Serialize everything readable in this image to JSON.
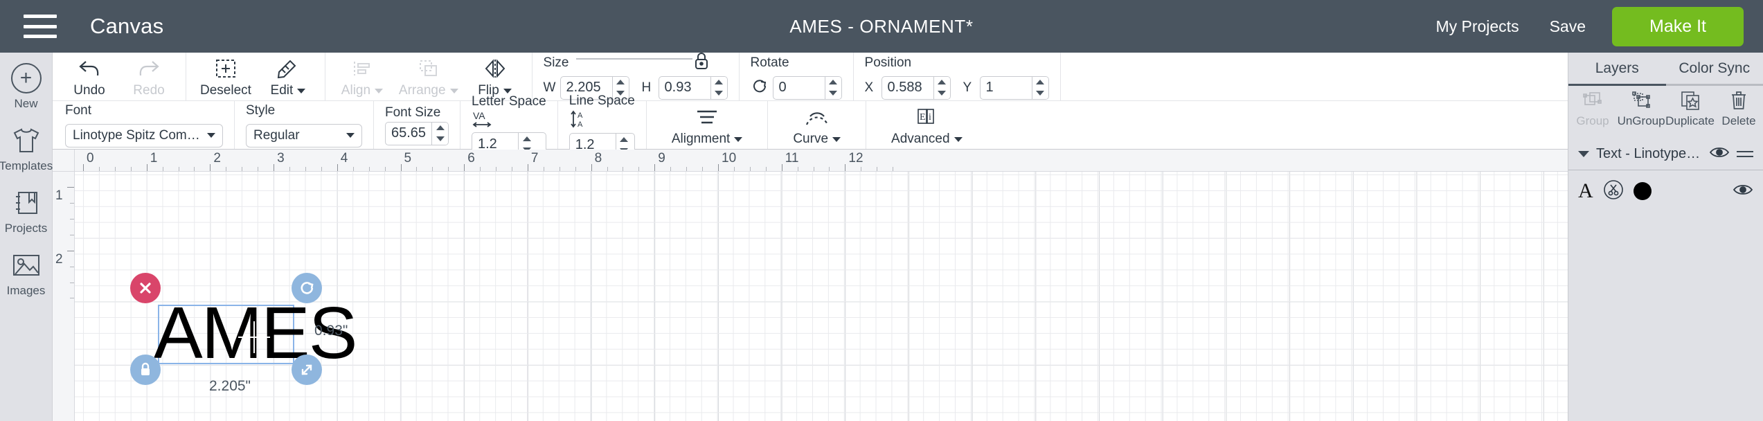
{
  "topbar": {
    "menu_icon": "hamburger-icon",
    "canvas_label": "Canvas",
    "document_title": "AMES - ORNAMENT*",
    "my_projects": "My Projects",
    "save": "Save",
    "make_it": "Make It",
    "accent_green": "#74bc1f",
    "bar_color": "#4a5560"
  },
  "rail": {
    "items": [
      {
        "label": "New",
        "icon": "plus-circle-icon"
      },
      {
        "label": "Templates",
        "icon": "tshirt-icon"
      },
      {
        "label": "Projects",
        "icon": "bookmark-book-icon"
      },
      {
        "label": "Images",
        "icon": "image-icon"
      }
    ]
  },
  "toolbar_row1": {
    "history": [
      {
        "label": "Undo",
        "icon": "undo-arrow-icon",
        "disabled": false
      },
      {
        "label": "Redo",
        "icon": "redo-arrow-icon",
        "disabled": true
      }
    ],
    "edit_group": [
      {
        "label": "Deselect",
        "icon": "deselect-icon",
        "disabled": false
      },
      {
        "label": "Edit",
        "icon": "edit-pencil-ruler-icon",
        "disabled": false,
        "caret": true
      }
    ],
    "object_group": [
      {
        "label": "Align",
        "icon": "align-icon",
        "disabled": true,
        "caret": true
      },
      {
        "label": "Arrange",
        "icon": "arrange-icon",
        "disabled": true,
        "caret": true
      },
      {
        "label": "Flip",
        "icon": "flip-icon",
        "disabled": false,
        "caret": true
      }
    ],
    "size": {
      "label": "Size",
      "lock_icon": "lock-closed-icon",
      "w_axis": "W",
      "w_value": "2.205",
      "h_axis": "H",
      "h_value": "0.93"
    },
    "rotate": {
      "label": "Rotate",
      "icon": "rotate-icon",
      "value": "0"
    },
    "position": {
      "label": "Position",
      "x_axis": "X",
      "x_value": "0.588",
      "y_axis": "Y",
      "y_value": "1"
    }
  },
  "toolbar_row2": {
    "font": {
      "label": "Font",
      "value": "Linotype Spitz Com Light"
    },
    "style": {
      "label": "Style",
      "value": "Regular"
    },
    "font_size": {
      "label": "Font Size",
      "value": "65.65"
    },
    "letter_space": {
      "label": "Letter Space",
      "icon": "letter-space-icon",
      "value": "1.2"
    },
    "line_space": {
      "label": "Line Space",
      "icon": "line-space-icon",
      "value": "1.2"
    },
    "tools": [
      {
        "label": "Alignment",
        "icon": "text-alignment-icon",
        "caret": true
      },
      {
        "label": "Curve",
        "icon": "curve-text-icon",
        "caret": true
      },
      {
        "label": "Advanced",
        "icon": "advanced-text-icon",
        "caret": true
      }
    ]
  },
  "right_panel": {
    "tabs": [
      {
        "label": "Layers",
        "active": true
      },
      {
        "label": "Color Sync",
        "active": false
      }
    ],
    "actions": [
      {
        "label": "Group",
        "icon": "group-icon",
        "disabled": true
      },
      {
        "label": "UnGroup",
        "icon": "ungroup-icon",
        "disabled": false
      },
      {
        "label": "Duplicate",
        "icon": "duplicate-icon",
        "disabled": false
      },
      {
        "label": "Delete",
        "icon": "trash-icon",
        "disabled": false
      }
    ],
    "layer_group": {
      "name": "Text - Linotype Spitz Co...",
      "expand_icon": "triangle-down-icon",
      "visibility_icon": "eye-icon",
      "menu_icon": "hamburger-small-icon"
    },
    "layer_rows": [
      {
        "glyph": "A",
        "op_icon": "cut-scissors-icon",
        "color": "#000000",
        "visibility_icon": "eye-icon"
      }
    ]
  },
  "canvas": {
    "h_ruler_labels": [
      "0",
      "1",
      "2",
      "3",
      "4",
      "5",
      "6",
      "7",
      "8",
      "9",
      "10",
      "11",
      "12"
    ],
    "v_ruler_labels": [
      "1",
      "2"
    ],
    "object_text": "AMES",
    "width_dimension": "2.205\"",
    "height_dimension": "0.93\"",
    "handles": [
      {
        "name": "delete-handle",
        "icon": "x-icon",
        "color": "#d9456a"
      },
      {
        "name": "rotate-handle",
        "icon": "rotate-icon",
        "color": "#8fb6de"
      },
      {
        "name": "lock-handle",
        "icon": "lock-icon",
        "color": "#8fb6de"
      },
      {
        "name": "resize-handle",
        "icon": "resize-diagonal-icon",
        "color": "#8fb6de"
      }
    ],
    "selection_color": "#8ab4e8"
  }
}
